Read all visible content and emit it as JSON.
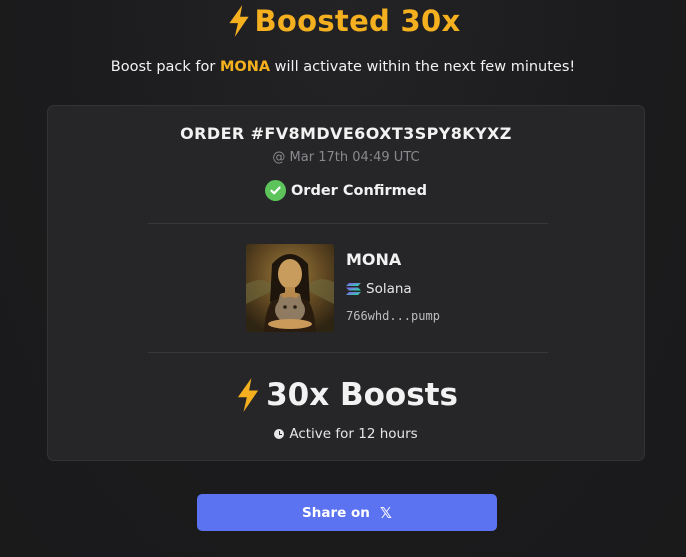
{
  "header": {
    "title": "Boosted 30x",
    "subtitle_prefix": "Boost pack for ",
    "subtitle_token": "MONA",
    "subtitle_suffix": " will activate within the next few minutes!"
  },
  "order": {
    "id": "ORDER #FV8MDVE6OXT3SPY8KYXZ",
    "time": "@ Mar 17th 04:49 UTC",
    "status": "Order Confirmed"
  },
  "token": {
    "name": "MONA",
    "chain": "Solana",
    "address": "766whd...pump"
  },
  "boost": {
    "label": "30x Boosts",
    "duration": "Active for 12 hours"
  },
  "share": {
    "label": "Share on",
    "icon_text": "𝕏"
  },
  "colors": {
    "accent": "#f5b01f",
    "button": "#5b73f0",
    "confirm": "#5cc45a"
  },
  "icons": {
    "title": "lightning-bolt-icon",
    "status": "check-circle-icon",
    "chain": "solana-icon",
    "duration": "clock-icon",
    "share": "x-logo-icon"
  }
}
